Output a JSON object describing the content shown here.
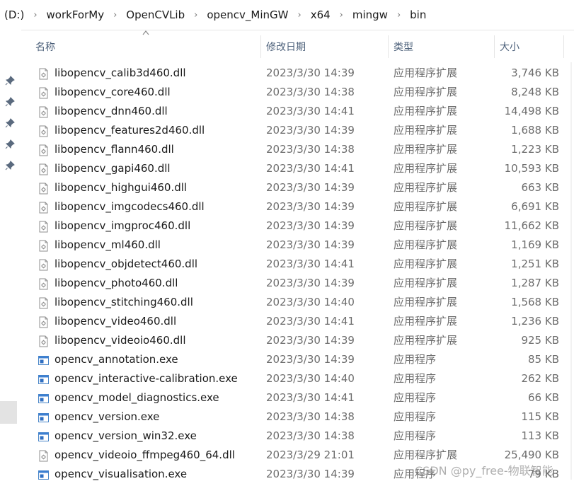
{
  "breadcrumb": [
    "(D:)",
    "workForMy",
    "OpenCVLib",
    "opencv_MinGW",
    "x64",
    "mingw",
    "bin"
  ],
  "columns": {
    "name": "名称",
    "date": "修改日期",
    "type": "类型",
    "size": "大小"
  },
  "icons": {
    "dll": "dll-file-icon",
    "exe": "exe-window-icon",
    "pin": "pin-icon",
    "separator": "chevron-right-icon",
    "sort": "sort-ascending-icon"
  },
  "files": [
    {
      "name": "libopencv_calib3d460.dll",
      "date": "2023/3/30 14:39",
      "type": "应用程序扩展",
      "size": "3,746 KB",
      "kind": "dll"
    },
    {
      "name": "libopencv_core460.dll",
      "date": "2023/3/30 14:38",
      "type": "应用程序扩展",
      "size": "8,248 KB",
      "kind": "dll"
    },
    {
      "name": "libopencv_dnn460.dll",
      "date": "2023/3/30 14:41",
      "type": "应用程序扩展",
      "size": "14,498 KB",
      "kind": "dll"
    },
    {
      "name": "libopencv_features2d460.dll",
      "date": "2023/3/30 14:39",
      "type": "应用程序扩展",
      "size": "1,688 KB",
      "kind": "dll"
    },
    {
      "name": "libopencv_flann460.dll",
      "date": "2023/3/30 14:38",
      "type": "应用程序扩展",
      "size": "1,223 KB",
      "kind": "dll"
    },
    {
      "name": "libopencv_gapi460.dll",
      "date": "2023/3/30 14:41",
      "type": "应用程序扩展",
      "size": "10,593 KB",
      "kind": "dll"
    },
    {
      "name": "libopencv_highgui460.dll",
      "date": "2023/3/30 14:39",
      "type": "应用程序扩展",
      "size": "663 KB",
      "kind": "dll"
    },
    {
      "name": "libopencv_imgcodecs460.dll",
      "date": "2023/3/30 14:39",
      "type": "应用程序扩展",
      "size": "6,691 KB",
      "kind": "dll"
    },
    {
      "name": "libopencv_imgproc460.dll",
      "date": "2023/3/30 14:39",
      "type": "应用程序扩展",
      "size": "11,662 KB",
      "kind": "dll"
    },
    {
      "name": "libopencv_ml460.dll",
      "date": "2023/3/30 14:39",
      "type": "应用程序扩展",
      "size": "1,169 KB",
      "kind": "dll"
    },
    {
      "name": "libopencv_objdetect460.dll",
      "date": "2023/3/30 14:41",
      "type": "应用程序扩展",
      "size": "1,251 KB",
      "kind": "dll"
    },
    {
      "name": "libopencv_photo460.dll",
      "date": "2023/3/30 14:39",
      "type": "应用程序扩展",
      "size": "1,287 KB",
      "kind": "dll"
    },
    {
      "name": "libopencv_stitching460.dll",
      "date": "2023/3/30 14:40",
      "type": "应用程序扩展",
      "size": "1,568 KB",
      "kind": "dll"
    },
    {
      "name": "libopencv_video460.dll",
      "date": "2023/3/30 14:41",
      "type": "应用程序扩展",
      "size": "1,236 KB",
      "kind": "dll"
    },
    {
      "name": "libopencv_videoio460.dll",
      "date": "2023/3/30 14:39",
      "type": "应用程序扩展",
      "size": "925 KB",
      "kind": "dll"
    },
    {
      "name": "opencv_annotation.exe",
      "date": "2023/3/30 14:39",
      "type": "应用程序",
      "size": "85 KB",
      "kind": "exe"
    },
    {
      "name": "opencv_interactive-calibration.exe",
      "date": "2023/3/30 14:40",
      "type": "应用程序",
      "size": "262 KB",
      "kind": "exe"
    },
    {
      "name": "opencv_model_diagnostics.exe",
      "date": "2023/3/30 14:41",
      "type": "应用程序",
      "size": "66 KB",
      "kind": "exe"
    },
    {
      "name": "opencv_version.exe",
      "date": "2023/3/30 14:38",
      "type": "应用程序",
      "size": "115 KB",
      "kind": "exe"
    },
    {
      "name": "opencv_version_win32.exe",
      "date": "2023/3/30 14:38",
      "type": "应用程序",
      "size": "113 KB",
      "kind": "exe"
    },
    {
      "name": "opencv_videoio_ffmpeg460_64.dll",
      "date": "2023/3/29 21:01",
      "type": "应用程序扩展",
      "size": "25,490 KB",
      "kind": "dll"
    },
    {
      "name": "opencv_visualisation.exe",
      "date": "2023/3/30 14:39",
      "type": "应用程序",
      "size": "79 KB",
      "kind": "exe"
    }
  ],
  "watermark": "CSDN @py_free-物联智能"
}
